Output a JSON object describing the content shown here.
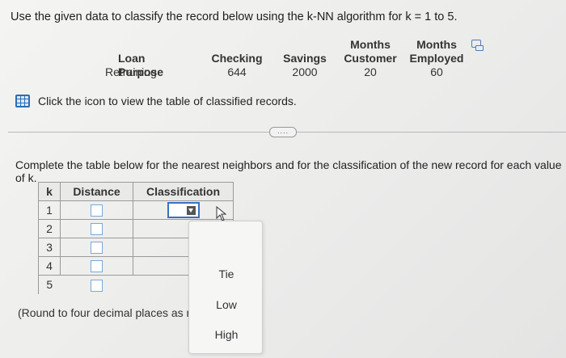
{
  "prompt": "Use the given data to classify the record below using the k-NN algorithm for k = 1 to 5.",
  "record": {
    "columns": [
      {
        "header_top": "",
        "header": "Loan Purpose",
        "value": "Retraining"
      },
      {
        "header_top": "",
        "header": "Checking",
        "value": "644"
      },
      {
        "header_top": "",
        "header": "Savings",
        "value": "2000"
      },
      {
        "header_top": "Months",
        "header": "Customer",
        "value": "20"
      },
      {
        "header_top": "Months",
        "header": "Employed",
        "value": "60"
      }
    ]
  },
  "table_link_text": "Click the icon to view the table of classified records.",
  "more_button": "....",
  "instruction": "Complete the table below for the nearest neighbors and for the classification of the new record for each value of k.",
  "neighbor_table": {
    "headers": {
      "k": "k",
      "distance": "Distance",
      "classification": "Classification"
    },
    "rows": [
      {
        "k": "1"
      },
      {
        "k": "2"
      },
      {
        "k": "3"
      },
      {
        "k": "4"
      },
      {
        "k": "5"
      }
    ]
  },
  "round_note": "(Round to four decimal places as needed.)",
  "dropdown_options": [
    "Tie",
    "Low",
    "High"
  ]
}
